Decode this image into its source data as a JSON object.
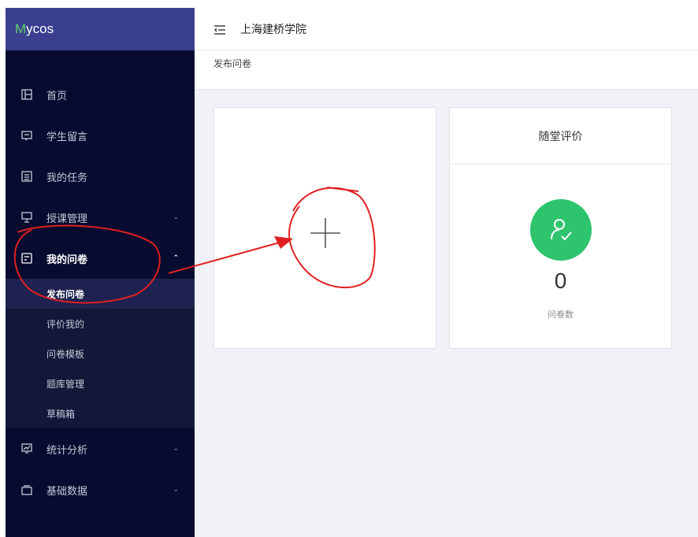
{
  "app": {
    "logo_m": "M",
    "logo_rest": "ycos"
  },
  "header": {
    "school_name": "上海建桥学院"
  },
  "breadcrumb": {
    "current": "发布问卷"
  },
  "sidebar": {
    "items": [
      {
        "label": "首页",
        "icon": "layout-icon"
      },
      {
        "label": "学生留言",
        "icon": "message-icon"
      },
      {
        "label": "我的任务",
        "icon": "calendar-icon"
      },
      {
        "label": "授课管理",
        "icon": "presentation-icon",
        "chevron": "⌄"
      },
      {
        "label": "我的问卷",
        "icon": "survey-icon",
        "chevron": "⌃"
      },
      {
        "label": "统计分析",
        "icon": "chart-icon",
        "chevron": "⌄"
      },
      {
        "label": "基础数据",
        "icon": "database-icon",
        "chevron": "⌄"
      }
    ],
    "submenu": [
      "发布问卷",
      "评价我的",
      "问卷模板",
      "题库管理",
      "草稿箱"
    ]
  },
  "cards": {
    "eval": {
      "title": "随堂评价",
      "count": "0",
      "label": "问卷数"
    }
  },
  "colors": {
    "sidebar_bg": "#070b2f",
    "logo_bar_bg": "#3a3f8f",
    "accent_green": "#2ec46e",
    "annotation_red": "#e02020"
  }
}
